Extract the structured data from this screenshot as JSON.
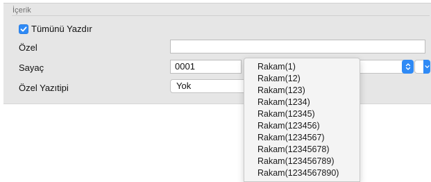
{
  "section": {
    "title": "İçerik"
  },
  "print_all": {
    "label": "Tümünü Yazdır",
    "checked": true
  },
  "custom": {
    "label": "Özel",
    "value": ""
  },
  "counter": {
    "label": "Sayaç",
    "value": "0001",
    "options": [
      "Rakam(1)",
      "Rakam(12)",
      "Rakam(123)",
      "Rakam(1234)",
      "Rakam(12345)",
      "Rakam(123456)",
      "Rakam(1234567)",
      "Rakam(12345678)",
      "Rakam(123456789)",
      "Rakam(1234567890)"
    ]
  },
  "custom_font": {
    "label": "Özel Yazıtipi",
    "value": "Yok"
  },
  "colors": {
    "accent": "#2f8af5",
    "panel": "#e6e6e6"
  },
  "icons": {
    "checkbox": "checkmark-icon",
    "stepper": "up-down-chevron-icon",
    "combo": "chevron-down-icon"
  }
}
